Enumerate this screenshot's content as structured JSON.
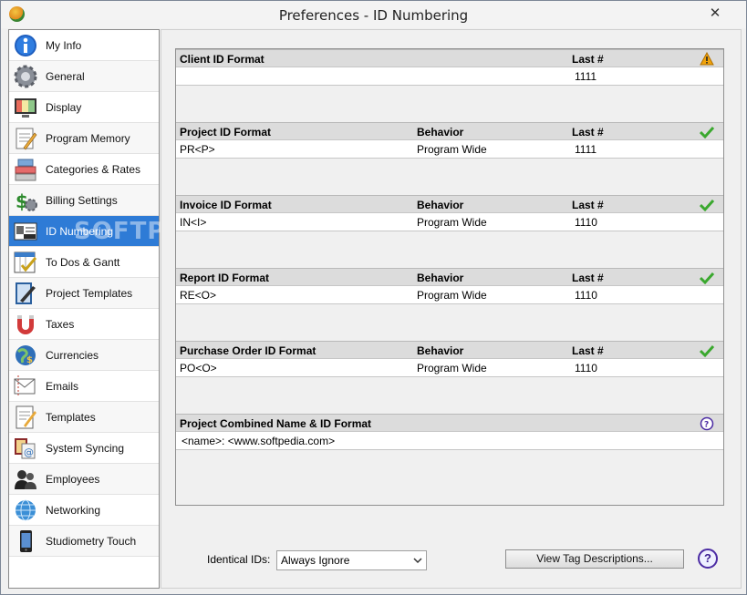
{
  "window": {
    "title": "Preferences - ID Numbering",
    "close_glyph": "✕"
  },
  "sidebar": {
    "items": [
      {
        "label": "My Info",
        "icon": "info-icon"
      },
      {
        "label": "General",
        "icon": "gear-icon"
      },
      {
        "label": "Display",
        "icon": "monitor-icon"
      },
      {
        "label": "Program Memory",
        "icon": "memory-notepad-icon"
      },
      {
        "label": "Categories & Rates",
        "icon": "categories-icon"
      },
      {
        "label": "Billing Settings",
        "icon": "billing-icon"
      },
      {
        "label": "ID Numbering",
        "icon": "id-card-icon",
        "selected": true
      },
      {
        "label": "To Dos & Gantt",
        "icon": "todo-calendar-icon"
      },
      {
        "label": "Project Templates",
        "icon": "project-template-icon"
      },
      {
        "label": "Taxes",
        "icon": "magnet-icon"
      },
      {
        "label": "Currencies",
        "icon": "currency-globe-icon"
      },
      {
        "label": "Emails",
        "icon": "envelope-icon"
      },
      {
        "label": "Templates",
        "icon": "templates-icon"
      },
      {
        "label": "System Syncing",
        "icon": "sync-icon"
      },
      {
        "label": "Employees",
        "icon": "employees-icon"
      },
      {
        "label": "Networking",
        "icon": "network-globe-icon"
      },
      {
        "label": "Studiometry Touch",
        "icon": "phone-icon"
      }
    ]
  },
  "watermark": "SOFTPEDIA",
  "sections": [
    {
      "title": "Client ID Format",
      "behavior_header": "",
      "last_header": "Last #",
      "format": "",
      "behavior": "",
      "last": "1111",
      "status": "warning-icon"
    },
    {
      "title": "Project ID Format",
      "behavior_header": "Behavior",
      "last_header": "Last #",
      "format": "PR<P>",
      "behavior": "Program Wide",
      "last": "1111",
      "status": "checkmark-icon"
    },
    {
      "title": "Invoice ID Format",
      "behavior_header": "Behavior",
      "last_header": "Last #",
      "format": "IN<I>",
      "behavior": "Program Wide",
      "last": "1110",
      "status": "checkmark-icon"
    },
    {
      "title": "Report ID Format",
      "behavior_header": "Behavior",
      "last_header": "Last #",
      "format": "RE<O>",
      "behavior": "Program Wide",
      "last": "1110",
      "status": "checkmark-icon"
    },
    {
      "title": "Purchase Order ID Format",
      "behavior_header": "Behavior",
      "last_header": "Last #",
      "format": "PO<O>",
      "behavior": "Program Wide",
      "last": "1110",
      "status": "checkmark-icon"
    },
    {
      "title": "Project Combined Name & ID Format",
      "behavior_header": "",
      "last_header": "",
      "format": "<name>: <www.softpedia.com>",
      "behavior": "",
      "last": "",
      "status": "help-icon"
    }
  ],
  "bottom": {
    "identical_label": "Identical IDs:",
    "identical_value": "Always Ignore",
    "view_tags_label": "View Tag Descriptions...",
    "help_glyph": "?"
  },
  "colors": {
    "selected_nav": "#2e7bd6",
    "check_green": "#3aa82e",
    "warning_orange": "#f0a30a",
    "help_purple": "#4b2ba3"
  }
}
